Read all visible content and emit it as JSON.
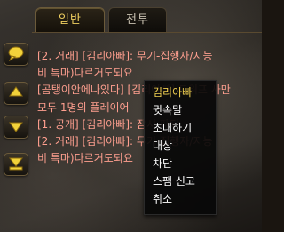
{
  "tabs": [
    {
      "label": "일반",
      "active": true
    },
    {
      "label": "전투",
      "active": false
    }
  ],
  "side_buttons": [
    {
      "icon": "speech-bubble-icon"
    },
    {
      "icon": "arrow-up-icon"
    },
    {
      "icon": "arrow-down-icon"
    },
    {
      "icon": "arrow-bottom-icon"
    }
  ],
  "chat": {
    "lines": [
      "[2. 거래] [김리아빠]: 무기-집행자/지능",
      "비 특마)다르거도되요",
      "[곰탱이안에나있다] [김리아빠] 드워프 사만",
      "모두 1명의 플레이어",
      "[1. 공개] [김리아빠]: 잠시 파티",
      "[2. 거래] [김리아빠]: 무기-집행자/지능",
      "비 특마)다르거도되요"
    ]
  },
  "context_menu": {
    "title": "김리아빠",
    "items": [
      "귓속말",
      "초대하기",
      "대상",
      "차단",
      "스팸 신고",
      "취소"
    ]
  },
  "colors": {
    "chat_text": "#ff9f8f",
    "menu_title": "#f0d050",
    "tab_active": "#f0d060"
  }
}
